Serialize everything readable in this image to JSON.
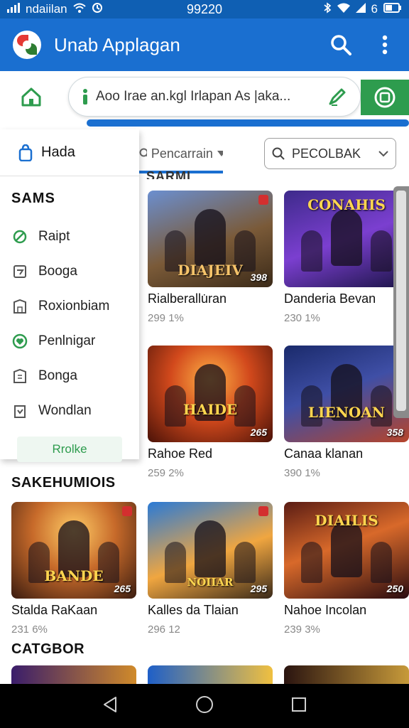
{
  "status_bar": {
    "carrier": "ndaiilan",
    "time": "99220",
    "battery": "6"
  },
  "app_bar": {
    "title": "Unab Applagan"
  },
  "search": {
    "value": "Aoo Irae an.kgl Irlapan As |aka..."
  },
  "filters": {
    "tab_label": "Pencarrain",
    "select_value": "PECOLBAK"
  },
  "drawer": {
    "header": "Hada",
    "section": "SAMS",
    "items": [
      {
        "label": "Raipt",
        "icon": "leaf-icon"
      },
      {
        "label": "Booga",
        "icon": "calendar-icon"
      },
      {
        "label": "Roxionbiam",
        "icon": "building-icon"
      },
      {
        "label": "Penlnigar",
        "icon": "heart-icon"
      },
      {
        "label": "Bonga",
        "icon": "building-icon"
      },
      {
        "label": "Wondlan",
        "icon": "tag-icon"
      }
    ],
    "footer_button": "Rrolke"
  },
  "partial_section": "SARMI",
  "sections": [
    {
      "title": "SAKEHUMIOIS"
    },
    {
      "title": "CATGBOR"
    }
  ],
  "games_top": [
    {
      "name": "Rialberallu̇ran",
      "meta": "299 1%",
      "logo": "DIAJEIV",
      "badge": "398"
    },
    {
      "name": "Danderia Bevan",
      "meta": "230 1%",
      "logo": "CONAHIS",
      "badge": ""
    },
    {
      "name": "Rahoe Red",
      "meta": "259 2%",
      "logo": "HAIDE",
      "badge": "265"
    },
    {
      "name": "Canaa klanan",
      "meta": "390 1%",
      "logo": "LIENOAN",
      "badge": "358"
    }
  ],
  "games_row3": [
    {
      "name": "Stalda RaKaan",
      "meta": "231 6%",
      "logo": "BANDE",
      "badge": "265"
    },
    {
      "name": "Kalles da Tlaian",
      "meta": "296 12",
      "logo": "NOIIAR",
      "badge": "295"
    },
    {
      "name": "Nahoe Incolan",
      "meta": "239 3%",
      "logo": "DIAILIS",
      "badge": "250"
    }
  ],
  "colors": {
    "primary": "#1a6fd0",
    "accent": "#2e9c4e"
  }
}
